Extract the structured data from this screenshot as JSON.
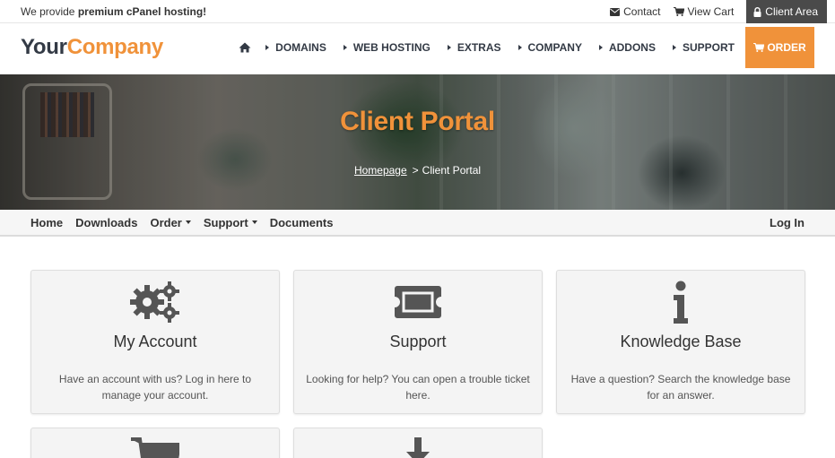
{
  "topbar": {
    "promo_prefix": "We provide ",
    "promo_bold": "premium cPanel hosting!",
    "contact": "Contact",
    "view_cart": "View Cart",
    "client_area": "Client Area"
  },
  "header": {
    "logo_part1": "Your",
    "logo_part2": "Company",
    "nav": [
      "DOMAINS",
      "WEB HOSTING",
      "EXTRAS",
      "COMPANY",
      "ADDONS",
      "SUPPORT"
    ],
    "order": "ORDER"
  },
  "hero": {
    "title": "Client Portal",
    "breadcrumb_home": "Homepage",
    "breadcrumb_sep": ">",
    "breadcrumb_current": "Client Portal"
  },
  "subnav": {
    "items": [
      "Home",
      "Downloads",
      "Order",
      "Support",
      "Documents"
    ],
    "login": "Log In"
  },
  "cards": [
    {
      "icon": "gears-icon",
      "title": "My Account",
      "desc": "Have an account with us? Log in here to manage your account."
    },
    {
      "icon": "ticket-icon",
      "title": "Support",
      "desc": "Looking for help? You can open a trouble ticket here."
    },
    {
      "icon": "info-icon",
      "title": "Knowledge Base",
      "desc": "Have a question? Search the knowledge base for an answer."
    },
    {
      "icon": "cart-icon",
      "title": "",
      "desc": ""
    },
    {
      "icon": "download-icon",
      "title": "",
      "desc": ""
    }
  ],
  "colors": {
    "accent": "#f0923a",
    "dark": "#333a45",
    "client_area_bg": "#4a4a4a",
    "card_bg": "#f4f4f4",
    "icon": "#555555"
  }
}
